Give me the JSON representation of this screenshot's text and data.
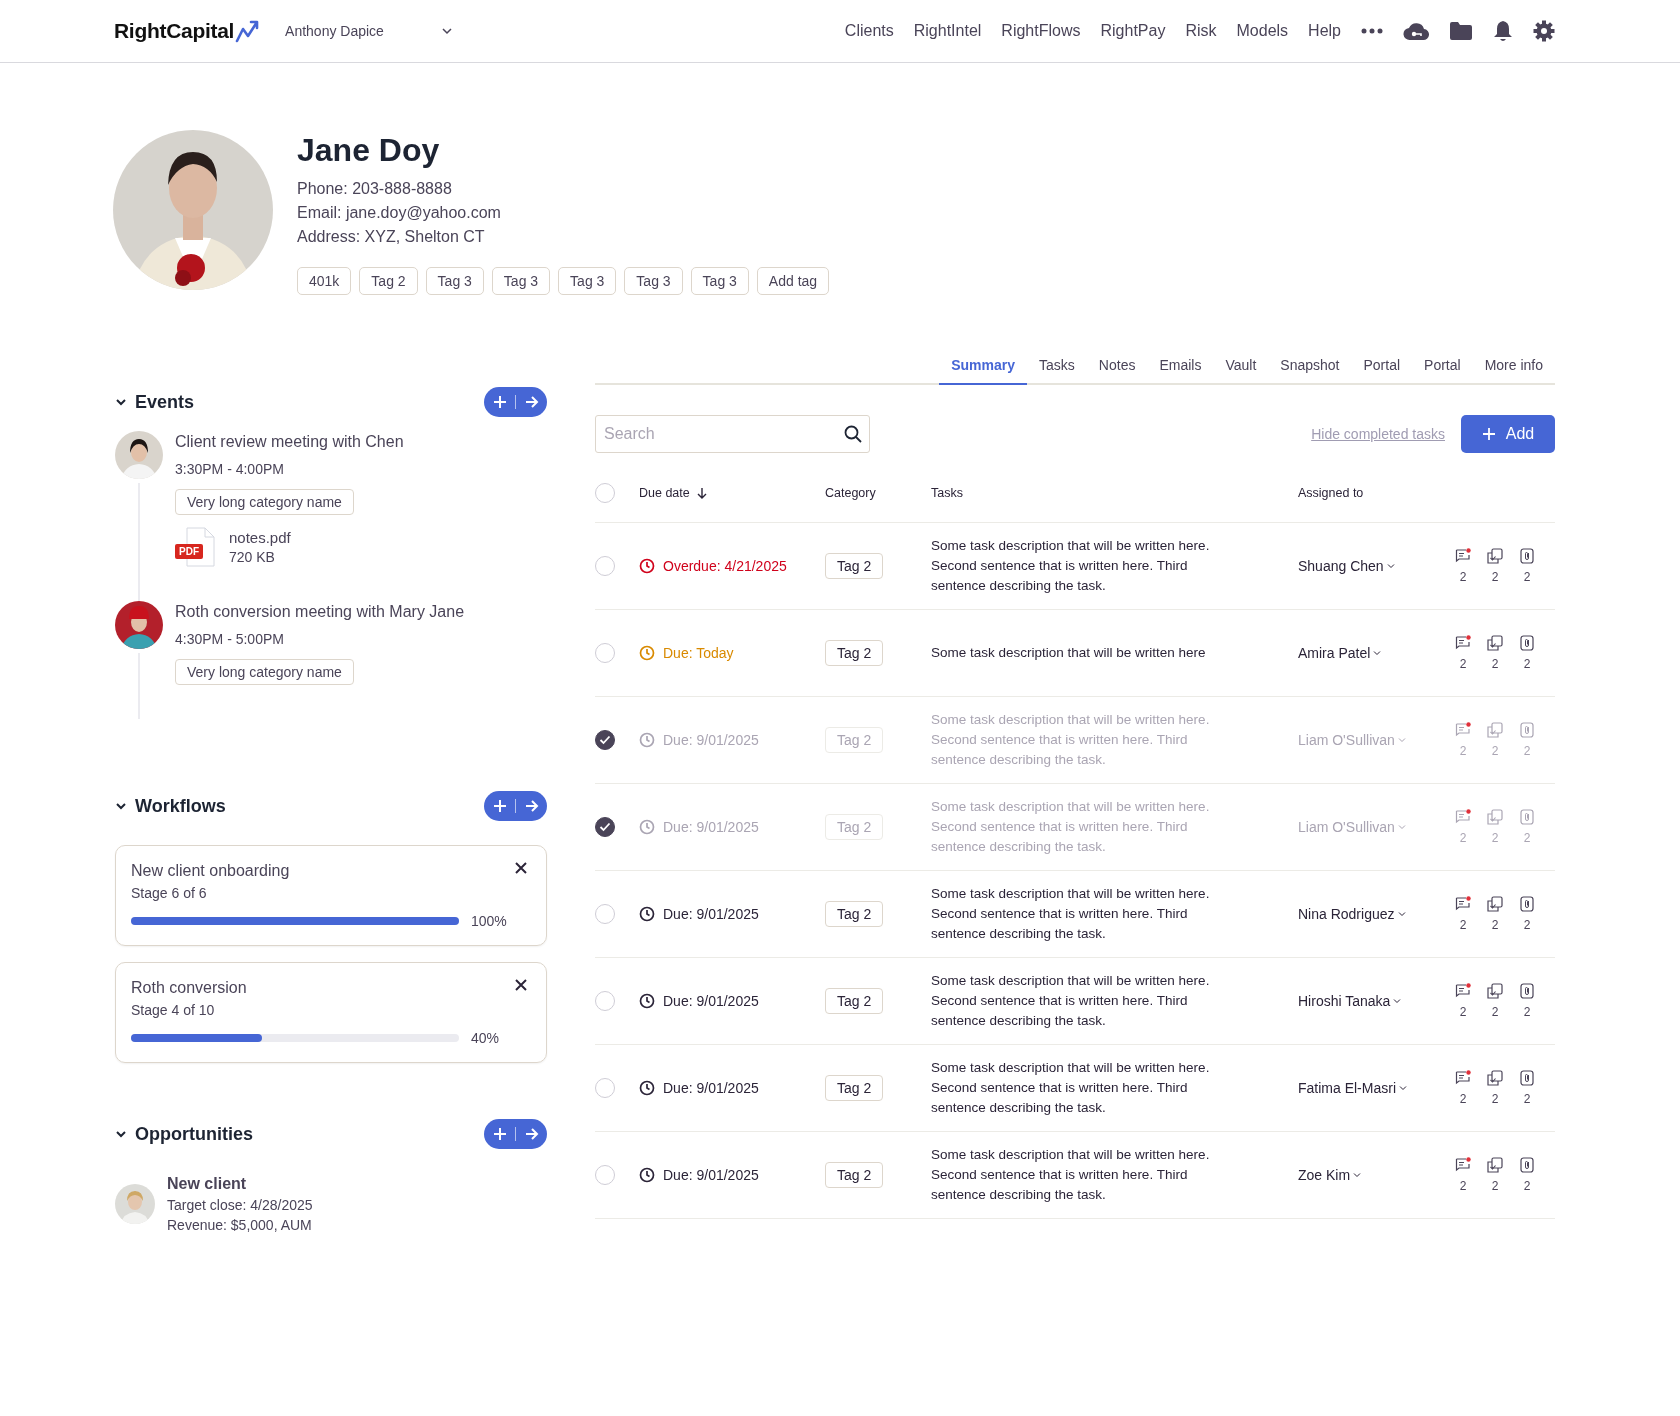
{
  "header": {
    "brand": "RightCapital",
    "user": "Anthony Dapice",
    "links": [
      "Clients",
      "RightIntel",
      "RightFlows",
      "RightPay",
      "Risk",
      "Models",
      "Help"
    ]
  },
  "profile": {
    "name": "Jane Doy",
    "lines": [
      "Phone: 203-888-8888",
      "Email: jane.doy@yahoo.com",
      "Address: XYZ, Shelton CT"
    ],
    "tags": [
      "401k",
      "Tag 2",
      "Tag 3",
      "Tag 3",
      "Tag 3",
      "Tag 3",
      "Tag 3"
    ],
    "add_tag": "Add tag"
  },
  "events": {
    "title": "Events",
    "expanded": true,
    "items": [
      {
        "title": "Client review meeting with Chen",
        "time": "3:30PM - 4:00PM",
        "category": "Very long category name",
        "attachment": {
          "badge": "PDF",
          "name": "notes.pdf",
          "size": "720 KB"
        }
      },
      {
        "title": "Roth conversion meeting with Mary Jane",
        "time": "4:30PM - 5:00PM",
        "category": "Very long category name"
      }
    ]
  },
  "workflows": {
    "title": "Workflows",
    "expanded": true,
    "items": [
      {
        "title": "New client onboarding",
        "stage": "Stage 6 of 6",
        "level": 1.0,
        "percent": "100%"
      },
      {
        "title": "Roth conversion",
        "stage": "Stage 4 of 10",
        "level": 0.4,
        "percent": "40%"
      }
    ]
  },
  "opportunities": {
    "title": "Opportunities",
    "expanded": true,
    "items": [
      {
        "title": "New client",
        "target": "Target close: 4/28/2025",
        "revenue": "Revenue: $5,000, AUM"
      }
    ]
  },
  "tabs": [
    {
      "label": "Summary",
      "selected": true
    },
    {
      "label": "Tasks",
      "selected": false
    },
    {
      "label": "Notes",
      "selected": false
    },
    {
      "label": "Emails",
      "selected": false
    },
    {
      "label": "Vault",
      "selected": false
    },
    {
      "label": "Snapshot",
      "selected": false
    },
    {
      "label": "Portal",
      "selected": false
    },
    {
      "label": "Portal",
      "selected": false
    },
    {
      "label": "More info",
      "selected": false
    }
  ],
  "toolbar": {
    "search": {
      "placeholder": "Search"
    },
    "hide_link": "Hide completed tasks",
    "add_button": "Add"
  },
  "table": {
    "select_all": {
      "checked": false
    },
    "columns": [
      "Due date",
      "Category",
      "Tasks",
      "Assigned to"
    ],
    "rows": [
      {
        "checked": false,
        "color": "#d0021b",
        "due": "Overdue: 4/21/2025",
        "tag": "Tag 2",
        "description": "Some task description that will be written here. Second sentence that is written here. Third sentence describing the task.",
        "assignee": "Shuang Chen",
        "counts": [
          "2",
          "2",
          "2"
        ]
      },
      {
        "checked": false,
        "color": "#d98a00",
        "due": "Due: Today",
        "tag": "Tag 2",
        "description": "Some task description that will be written here",
        "assignee": "Amira Patel",
        "counts": [
          "2",
          "2",
          "2"
        ]
      },
      {
        "checked": true,
        "color": "#aaa5b3",
        "due": "Due: 9/01/2025",
        "tag": "Tag 2",
        "description": "Some task description that will be written here. Second sentence that is written here. Third sentence describing the task.",
        "assignee": "Liam O'Sullivan",
        "counts": [
          "2",
          "2",
          "2"
        ]
      },
      {
        "checked": true,
        "color": "#aaa5b3",
        "due": "Due: 9/01/2025",
        "tag": "Tag 2",
        "description": "Some task description that will be written here. Second sentence that is written here. Third sentence describing the task.",
        "assignee": "Liam O'Sullivan",
        "counts": [
          "2",
          "2",
          "2"
        ]
      },
      {
        "checked": false,
        "color": "#2b2438",
        "due": "Due: 9/01/2025",
        "tag": "Tag 2",
        "description": "Some task description that will be written here. Second sentence that is written here. Third sentence describing the task.",
        "assignee": "Nina Rodriguez",
        "counts": [
          "2",
          "2",
          "2"
        ]
      },
      {
        "checked": false,
        "color": "#2b2438",
        "due": "Due: 9/01/2025",
        "tag": "Tag 2",
        "description": "Some task description that will be written here. Second sentence that is written here. Third sentence describing the task.",
        "assignee": "Hiroshi Tanaka",
        "counts": [
          "2",
          "2",
          "2"
        ]
      },
      {
        "checked": false,
        "color": "#2b2438",
        "due": "Due: 9/01/2025",
        "tag": "Tag 2",
        "description": "Some task description that will be written here. Second sentence that is written here. Third sentence describing the task.",
        "assignee": "Fatima El-Masri",
        "counts": [
          "2",
          "2",
          "2"
        ]
      },
      {
        "checked": false,
        "color": "#2b2438",
        "due": "Due: 9/01/2025",
        "tag": "Tag 2",
        "description": "Some task description that will be written here. Second sentence that is written here. Third sentence describing the task.",
        "assignee": "Zoe Kim",
        "counts": [
          "2",
          "2",
          "2"
        ]
      }
    ]
  }
}
